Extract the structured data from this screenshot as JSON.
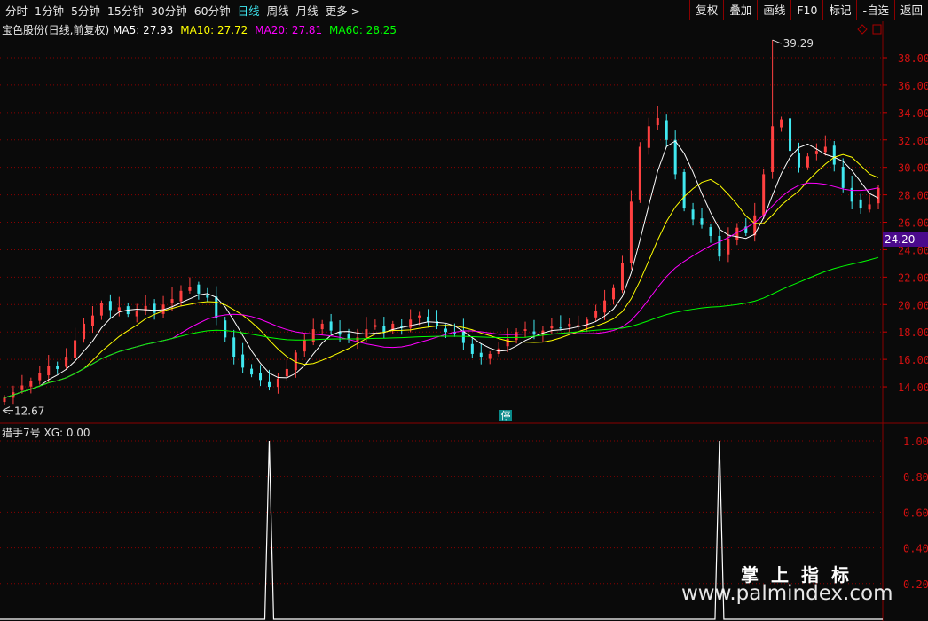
{
  "toolbar": {
    "periods": [
      "分时",
      "1分钟",
      "5分钟",
      "15分钟",
      "30分钟",
      "60分钟",
      "日线",
      "周线",
      "月线",
      "更多 >"
    ],
    "active_period": "日线",
    "buttons": [
      "复权",
      "叠加",
      "画线",
      "F10",
      "标记",
      "-自选",
      "返回"
    ]
  },
  "legend": {
    "title": "宝色股份(日线,前复权)",
    "ma5": "MA5: 27.93",
    "ma10": "MA10: 27.72",
    "ma20": "MA20: 27.81",
    "ma60": "MA60: 28.25"
  },
  "indicator": {
    "name": "猎手7号",
    "value": "XG: 0.00"
  },
  "markers": {
    "high": "39.29",
    "low": "12.67",
    "current_price": "24.20",
    "suspend": "停"
  },
  "watermark": {
    "cn": "掌上指标",
    "url": "www.palmindex.com"
  },
  "colors": {
    "up": "#ff4040",
    "down": "#40e8f0",
    "ma5": "#ffffff",
    "ma10": "#ffff00",
    "ma20": "#ff00ff",
    "ma60": "#00ff00",
    "grid": "#8b0000"
  },
  "chart_data": [
    {
      "type": "candlestick",
      "title": "宝色股份 日线",
      "ylim": [
        12.5,
        40
      ],
      "yticks": [
        "14.00",
        "16.00",
        "18.00",
        "20.00",
        "22.00",
        "24.00",
        "26.00",
        "28.00",
        "30.00",
        "32.00",
        "34.00",
        "36.00",
        "38.00"
      ],
      "closes": [
        13.2,
        13.6,
        14.1,
        14.4,
        15.0,
        15.5,
        15.3,
        16.2,
        17.4,
        18.6,
        19.2,
        20.1,
        19.6,
        19.8,
        19.3,
        19.5,
        19.9,
        19.4,
        20.0,
        20.4,
        21.0,
        21.3,
        20.8,
        20.5,
        19.0,
        17.6,
        16.2,
        15.4,
        14.9,
        14.5,
        14.0,
        14.6,
        15.3,
        16.5,
        17.4,
        18.2,
        18.6,
        18.1,
        17.8,
        17.5,
        17.6,
        18.2,
        18.5,
        18.0,
        18.6,
        18.3,
        18.9,
        19.2,
        18.7,
        18.4,
        18.0,
        17.9,
        17.2,
        16.4,
        16.2,
        16.4,
        16.8,
        17.5,
        18.0,
        18.2,
        17.8,
        18.1,
        18.4,
        18.3,
        18.6,
        18.5,
        18.9,
        19.5,
        20.3,
        21.2,
        23.0,
        27.5,
        31.5,
        33.0,
        33.6,
        32.0,
        29.5,
        27.0,
        26.2,
        25.8,
        25.0,
        23.5,
        24.8,
        25.6,
        25.2,
        26.5,
        29.5,
        33.0,
        33.5,
        31.2,
        30.0,
        30.8,
        31.2,
        31.5,
        30.2,
        28.5,
        27.5,
        27.0,
        27.3,
        28.5
      ],
      "high_max": 39.29,
      "high_index": 87,
      "low_min": 12.67,
      "low_index": 0
    },
    {
      "type": "line",
      "title": "猎手7号 XG",
      "ylim": [
        0,
        1
      ],
      "yticks": [
        "0.20",
        "0.40",
        "0.60",
        "0.80",
        "1.00"
      ],
      "signal_indices": [
        30,
        81
      ]
    }
  ]
}
